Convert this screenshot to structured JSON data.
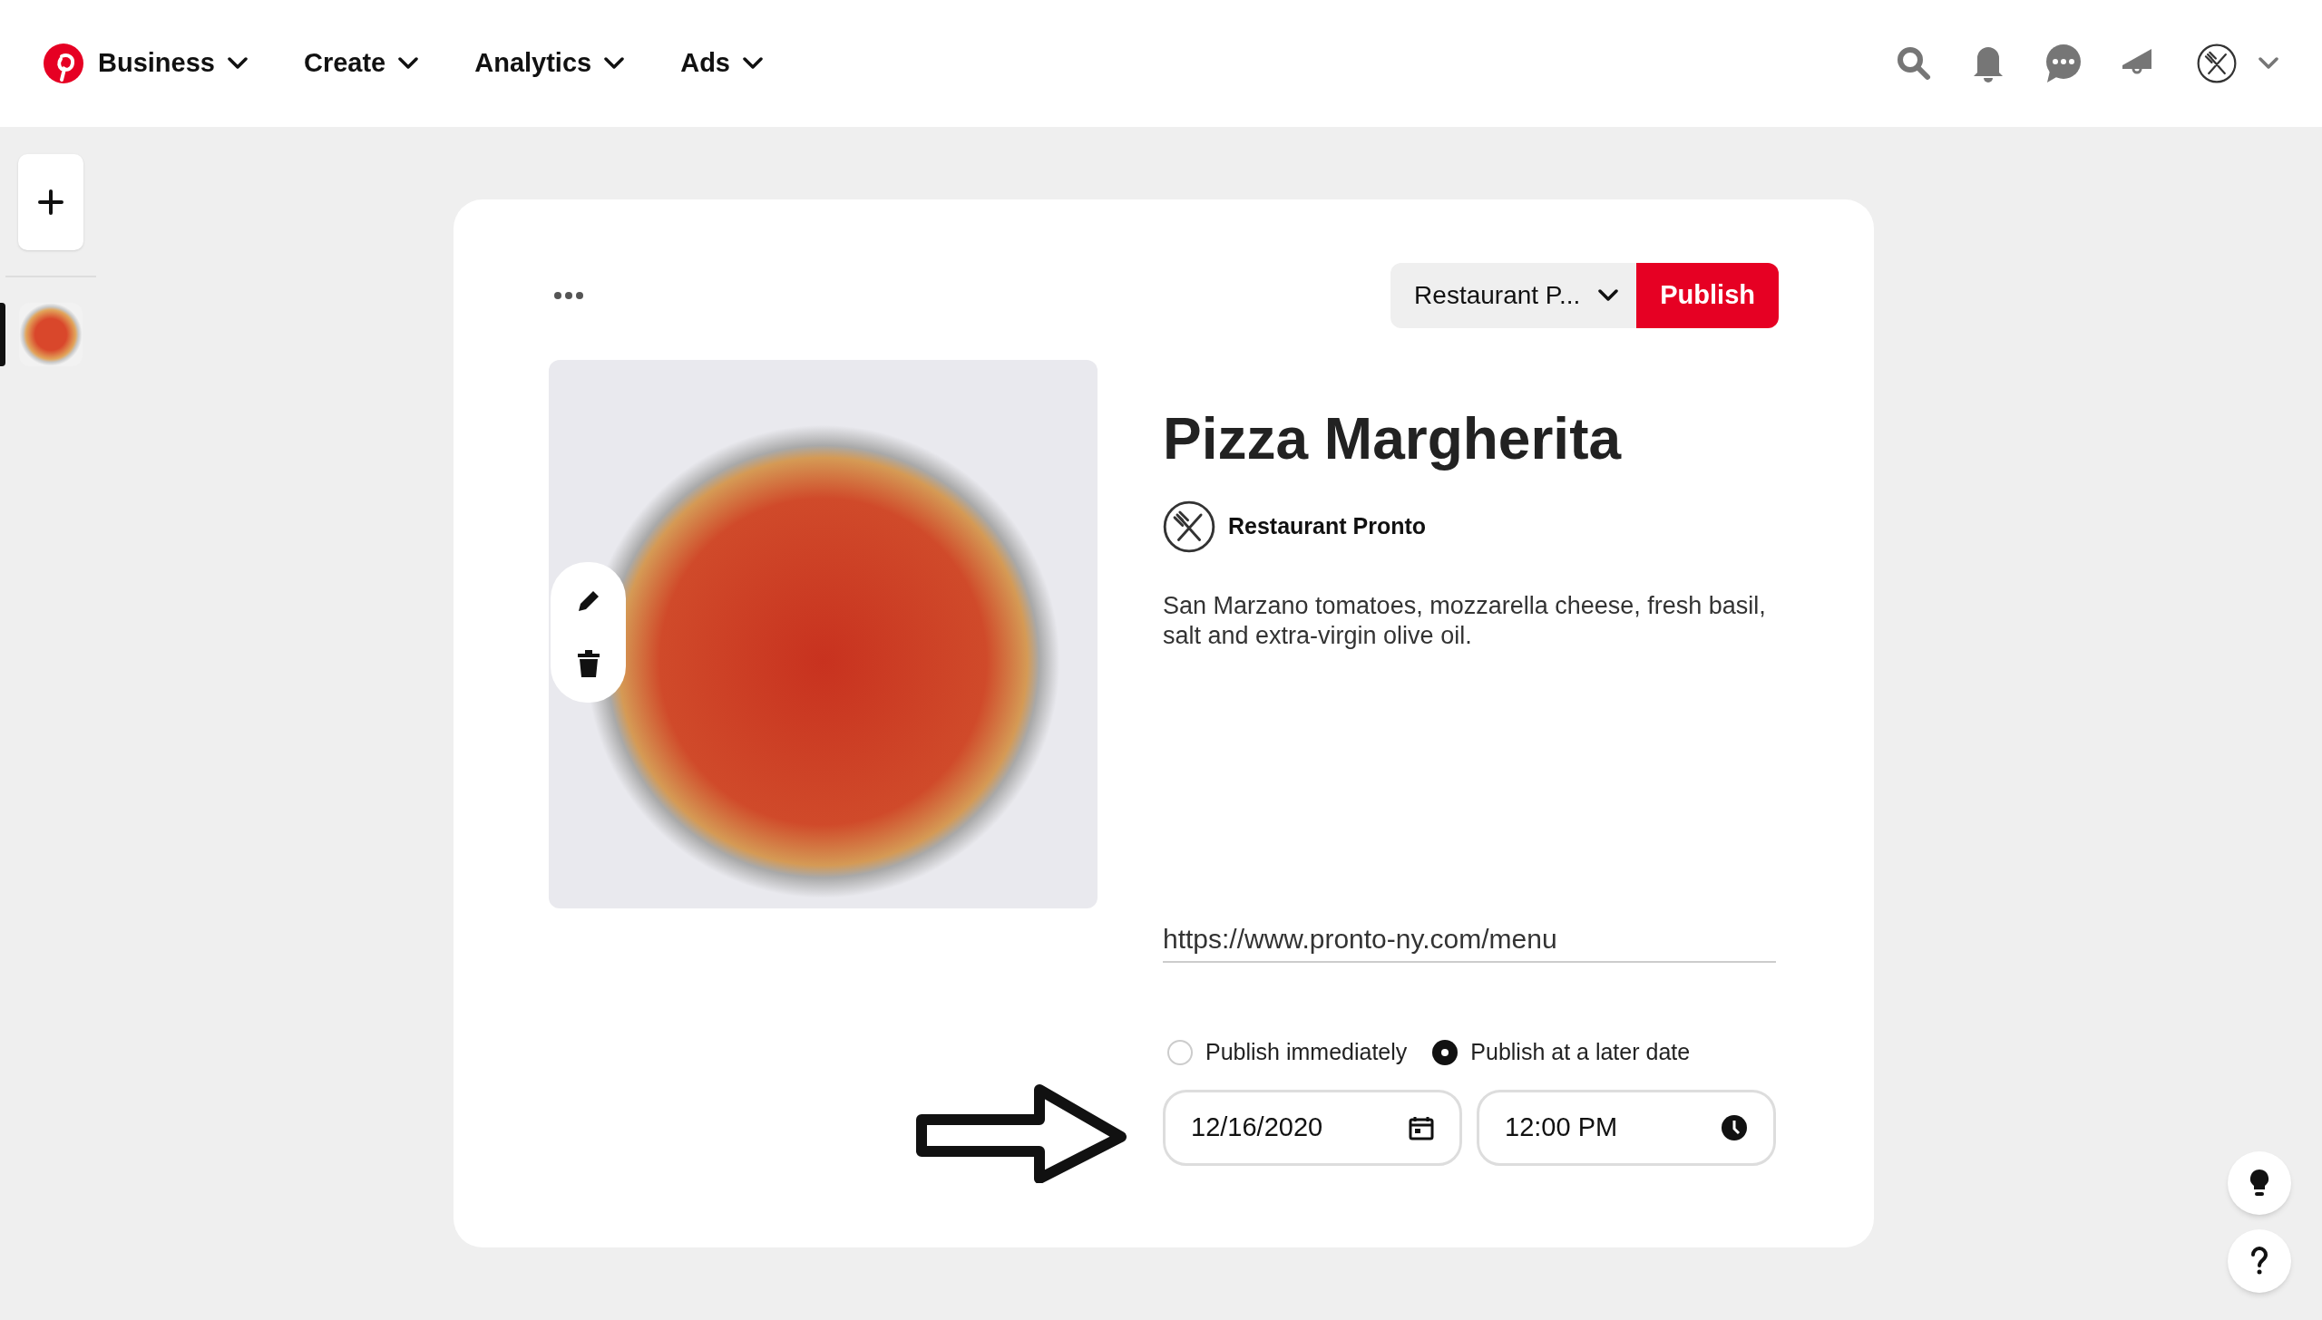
{
  "nav": {
    "brand": "Business",
    "menus": [
      "Create",
      "Analytics",
      "Ads"
    ]
  },
  "sidebar": {
    "items": [
      {
        "selected": true
      }
    ]
  },
  "pin": {
    "board": "Restaurant P...",
    "publish": "Publish",
    "title": "Pizza Margherita",
    "account": "Restaurant Pronto",
    "description": "San Marzano tomatoes, mozzarella cheese, fresh basil, salt and extra-virgin olive oil.",
    "link": "https://www.pronto-ny.com/menu",
    "schedule": [
      {
        "label": "Publish immediately",
        "selected": false
      },
      {
        "label": "Publish at a later date",
        "selected": true
      }
    ],
    "date": "12/16/2020",
    "time": "12:00 PM"
  }
}
